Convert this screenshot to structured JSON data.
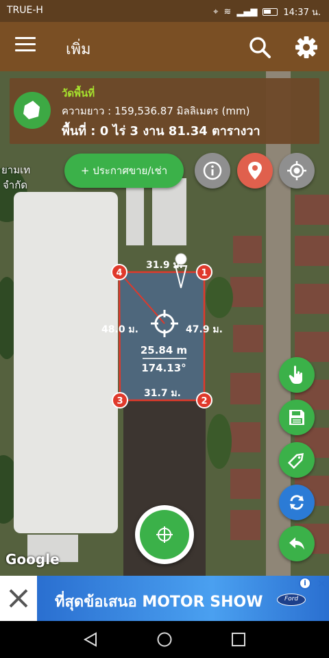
{
  "status": {
    "carrier": "TRUE-H",
    "time": "14:37 น."
  },
  "appbar": {
    "title": "เพิ่ม",
    "icons": [
      "menu-icon",
      "search-icon",
      "gear-icon"
    ]
  },
  "info": {
    "heading": "วัดพื้นที่",
    "length": "ความยาว : 159,536.87 มิลลิเมตร (mm)",
    "area": "พื้นที่ : 0 ไร่ 3 งาน 81.34 ตารางวา"
  },
  "map": {
    "labels": [
      "ยามเท",
      "จำกัด"
    ],
    "edge_top": "31.9 ม.",
    "edge_left": "48.0 ม.",
    "edge_right": "47.9 ม.",
    "edge_bottom": "31.7 ม.",
    "distance": "25.84 m",
    "bearing": "174.13°",
    "corners": [
      "1",
      "2",
      "3",
      "4"
    ],
    "attribution": "Google"
  },
  "buttons": {
    "announce": "+ ประกาศขาย/เช่า"
  },
  "ad": {
    "text": "ที่สุดข้อเสนอ MOTOR SHOW",
    "brand": "Ford"
  },
  "colors": {
    "appbar": "#7a4f24",
    "accent_green": "#3bb149",
    "polygon": "#e0392b"
  }
}
